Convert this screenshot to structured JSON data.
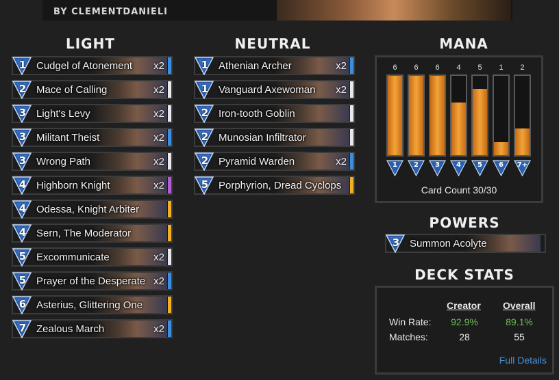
{
  "header": {
    "author": "BY CLEMENTDANIELI"
  },
  "sections": {
    "light": "LIGHT",
    "neutral": "NEUTRAL",
    "mana": "MANA",
    "powers": "POWERS",
    "deck_stats": "DECK STATS"
  },
  "colors": {
    "common": "#e8e8e8",
    "rare": "#3b8fe0",
    "epic": "#b45cd0",
    "legendary": "#f0b020",
    "accent_link": "#4a8fd6",
    "win_green": "#6cbf55",
    "mana_fill": "#f2a43a"
  },
  "light_cards": [
    {
      "cost": "1",
      "name": "Cudgel of Atonement",
      "qty": "x2",
      "rarity": "rare"
    },
    {
      "cost": "2",
      "name": "Mace of Calling",
      "qty": "x2",
      "rarity": "common"
    },
    {
      "cost": "3",
      "name": "Light's Levy",
      "qty": "x2",
      "rarity": "common"
    },
    {
      "cost": "3",
      "name": "Militant Theist",
      "qty": "x2",
      "rarity": "rare"
    },
    {
      "cost": "3",
      "name": "Wrong Path",
      "qty": "x2",
      "rarity": "common"
    },
    {
      "cost": "4",
      "name": "Highborn Knight",
      "qty": "x2",
      "rarity": "epic"
    },
    {
      "cost": "4",
      "name": "Odessa, Knight Arbiter",
      "qty": "",
      "rarity": "legendary"
    },
    {
      "cost": "4",
      "name": "Sern, The Moderator",
      "qty": "",
      "rarity": "legendary"
    },
    {
      "cost": "5",
      "name": "Excommunicate",
      "qty": "x2",
      "rarity": "common"
    },
    {
      "cost": "5",
      "name": "Prayer of the Desperate",
      "qty": "x2",
      "rarity": "rare"
    },
    {
      "cost": "6",
      "name": "Asterius, Glittering One",
      "qty": "",
      "rarity": "legendary"
    },
    {
      "cost": "7",
      "name": "Zealous March",
      "qty": "x2",
      "rarity": "rare"
    }
  ],
  "neutral_cards": [
    {
      "cost": "1",
      "name": "Athenian Archer",
      "qty": "x2",
      "rarity": "rare"
    },
    {
      "cost": "1",
      "name": "Vanguard Axewoman",
      "qty": "x2",
      "rarity": "common"
    },
    {
      "cost": "2",
      "name": "Iron-tooth Goblin",
      "qty": "",
      "rarity": "common"
    },
    {
      "cost": "2",
      "name": "Munosian Infiltrator",
      "qty": "",
      "rarity": "common"
    },
    {
      "cost": "2",
      "name": "Pyramid Warden",
      "qty": "x2",
      "rarity": "rare"
    },
    {
      "cost": "5",
      "name": "Porphyrion, Dread Cyclops",
      "qty": "",
      "rarity": "legendary"
    }
  ],
  "mana_curve": {
    "bars": [
      {
        "label": "1",
        "count": 6
      },
      {
        "label": "2",
        "count": 6
      },
      {
        "label": "3",
        "count": 6
      },
      {
        "label": "4",
        "count": 4
      },
      {
        "label": "5",
        "count": 5
      },
      {
        "label": "6",
        "count": 1
      },
      {
        "label": "7+",
        "count": 2
      }
    ],
    "max": 6,
    "card_count": "Card Count 30/30"
  },
  "powers": [
    {
      "cost": "3",
      "name": "Summon Acolyte"
    }
  ],
  "deck_stats": {
    "col_creator": "Creator",
    "col_overall": "Overall",
    "rows": [
      {
        "label": "Win Rate:",
        "creator": "92.9%",
        "overall": "89.1%"
      },
      {
        "label": "Matches:",
        "creator": "28",
        "overall": "55"
      }
    ],
    "link": "Full Details"
  }
}
